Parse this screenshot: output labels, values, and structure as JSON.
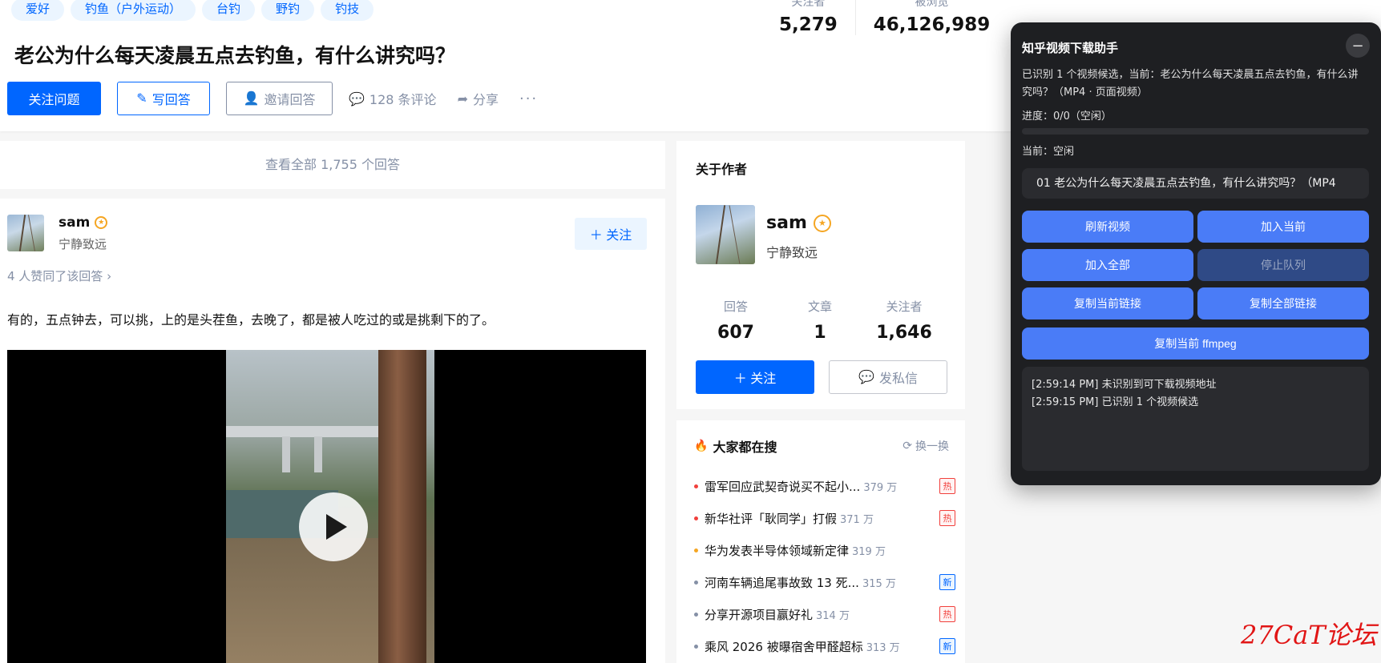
{
  "topics": [
    "爱好",
    "钓鱼（户外运动）",
    "台钓",
    "野钓",
    "钓技"
  ],
  "question": {
    "title": "老公为什么每天凌晨五点去钓鱼，有什么讲究吗？",
    "followers_label": "关注者",
    "followers": "5,279",
    "views_label": "被浏览",
    "views": "46,126,989"
  },
  "actions": {
    "follow_question": "关注问题",
    "write_answer": "写回答",
    "invite_answer": "邀请回答",
    "comments": "128 条评论",
    "share": "分享",
    "more": "···"
  },
  "view_all": "查看全部 1,755 个回答",
  "answer": {
    "author_name": "sam",
    "author_bio": "宁静致远",
    "follow_label": "关注",
    "agree_text": "4 人赞同了该回答 ›",
    "content": "有的，五点钟去，可以挑，上的是头茬鱼，去晚了，都是被人吃过的或是挑剩下的了。"
  },
  "about_author": {
    "title": "关于作者",
    "name": "sam",
    "bio": "宁静致远",
    "stats": [
      {
        "label": "回答",
        "value": "607"
      },
      {
        "label": "文章",
        "value": "1"
      },
      {
        "label": "关注者",
        "value": "1,646"
      }
    ],
    "follow_label": "关注",
    "message_label": "发私信"
  },
  "hot_search": {
    "title": "大家都在搜",
    "refresh_label": "换一换",
    "items": [
      {
        "text": "雷军回应武契奇说买不起小...",
        "heat": "379 万",
        "tag": "热",
        "tag_type": "hot",
        "bullet_color": "#f1403c"
      },
      {
        "text": "新华社评「耿同学」打假",
        "heat": "371 万",
        "tag": "热",
        "tag_type": "hot",
        "bullet_color": "#f1403c"
      },
      {
        "text": "华为发表半导体领域新定律",
        "heat": "319 万",
        "tag": "",
        "tag_type": "none",
        "bullet_color": "#f5a623"
      },
      {
        "text": "河南车辆追尾事故致 13 死...",
        "heat": "315 万",
        "tag": "新",
        "tag_type": "new",
        "bullet_color": "#8590a6"
      },
      {
        "text": "分享开源项目赢好礼",
        "heat": "314 万",
        "tag": "热",
        "tag_type": "hot",
        "bullet_color": "#8590a6"
      },
      {
        "text": "乘风 2026 被曝宿舍甲醛超标",
        "heat": "313 万",
        "tag": "新",
        "tag_type": "new",
        "bullet_color": "#8590a6"
      }
    ]
  },
  "panel": {
    "title": "知乎视频下载助手",
    "minimize": "−",
    "description": "已识别 1 个视频候选，当前：老公为什么每天凌晨五点去钓鱼，有什么讲究吗？（MP4 · 页面视频）",
    "progress_text": "进度：0/0（空闲）",
    "progress_fraction": 0,
    "current_text": "当前：空闲",
    "selected_video": "01 老公为什么每天凌晨五点去钓鱼，有什么讲究吗？（MP4",
    "buttons": {
      "refresh": "刷新视频",
      "add_current": "加入当前",
      "add_all": "加入全部",
      "stop_queue": "停止队列",
      "copy_current_link": "复制当前链接",
      "copy_all_links": "复制全部链接",
      "copy_ffmpeg": "复制当前 ffmpeg"
    },
    "log": [
      "[2:59:14 PM] 未识别到可下载视频地址",
      "[2:59:15 PM] 已识别 1 个视频候选"
    ]
  },
  "watermark": "27CaT论坛",
  "colors": {
    "accent": "#0066ff",
    "panel_bg": "#1e1f22",
    "panel_btn": "#4a7cf7",
    "hot_red": "#f1403c"
  }
}
